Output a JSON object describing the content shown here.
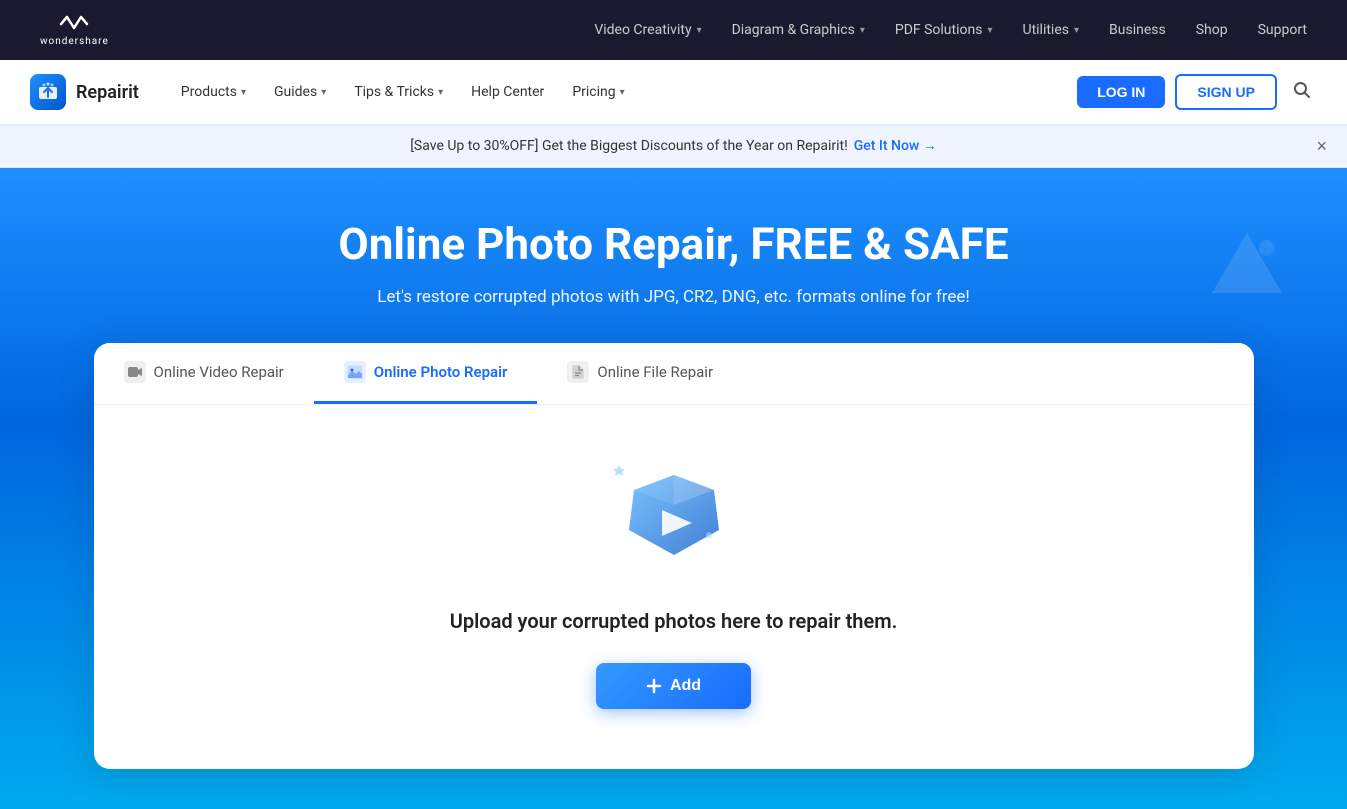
{
  "topNav": {
    "logo_text": "wondershare",
    "links": [
      {
        "label": "Video Creativity",
        "hasDropdown": true
      },
      {
        "label": "Diagram & Graphics",
        "hasDropdown": true
      },
      {
        "label": "PDF Solutions",
        "hasDropdown": true
      },
      {
        "label": "Utilities",
        "hasDropdown": true
      },
      {
        "label": "Business",
        "hasDropdown": false
      },
      {
        "label": "Shop",
        "hasDropdown": false
      },
      {
        "label": "Support",
        "hasDropdown": false
      }
    ]
  },
  "secondNav": {
    "brand": "Repairit",
    "links": [
      {
        "label": "Products",
        "hasDropdown": true
      },
      {
        "label": "Guides",
        "hasDropdown": true
      },
      {
        "label": "Tips & Tricks",
        "hasDropdown": true
      },
      {
        "label": "Help Center",
        "hasDropdown": false
      },
      {
        "label": "Pricing",
        "hasDropdown": true
      }
    ],
    "login_label": "LOG IN",
    "signup_label": "SIGN UP"
  },
  "banner": {
    "text": "[Save Up to 30%OFF] Get the Biggest Discounts of the Year on Repairit!",
    "link_text": "Get It Now →"
  },
  "hero": {
    "title": "Online Photo Repair, FREE & SAFE",
    "subtitle": "Let's restore corrupted photos with JPG, CR2, DNG, etc. formats online for free!"
  },
  "tabs": [
    {
      "id": "video",
      "label": "Online Video Repair",
      "icon": "🎥",
      "active": false
    },
    {
      "id": "photo",
      "label": "Online Photo Repair",
      "icon": "🖼",
      "active": true
    },
    {
      "id": "file",
      "label": "Online File Repair",
      "icon": "📄",
      "active": false
    }
  ],
  "uploadSection": {
    "text": "Upload your corrupted photos here to repair them.",
    "add_label": "+ Add"
  }
}
